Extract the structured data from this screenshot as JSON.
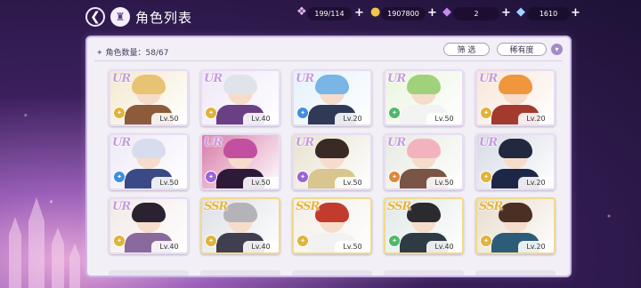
{
  "header": {
    "title": "角色列表"
  },
  "resources": [
    {
      "name": "candy",
      "icon": "candy-icon",
      "value": "199/114",
      "color": "#e7b6f0"
    },
    {
      "name": "coin",
      "icon": "coin-icon",
      "value": "1907800",
      "color": "#f3c54a"
    },
    {
      "name": "gem-purple",
      "icon": "gem-icon",
      "value": "2",
      "color": "#c48af0"
    },
    {
      "name": "gem-blue",
      "icon": "diamond-icon",
      "value": "1610",
      "color": "#9ed4ff"
    }
  ],
  "panel": {
    "count_label": "角色数量：58/67",
    "filter_label": "筛 选",
    "sort_label": "稀有度"
  },
  "cards": [
    {
      "rarity": "UR",
      "level": "Lv.50",
      "hair": "#e9c374",
      "outfit": "#8b5b3a",
      "bg": "#f3e9cf",
      "attr": "#e1b33a"
    },
    {
      "rarity": "UR",
      "level": "Lv.40",
      "hair": "#dfe3ea",
      "outfit": "#6b3f84",
      "bg": "#efe7f7",
      "attr": "#e1b33a"
    },
    {
      "rarity": "UR",
      "level": "Lv.20",
      "hair": "#79b6e6",
      "outfit": "#2f3a56",
      "bg": "#e4f1fa",
      "attr": "#3f8ee0"
    },
    {
      "rarity": "UR",
      "level": "Lv.50",
      "hair": "#9fd27a",
      "outfit": "#f3f3f3",
      "bg": "#eaf5e0",
      "attr": "#4fb86a"
    },
    {
      "rarity": "UR",
      "level": "Lv.20",
      "hair": "#f0963c",
      "outfit": "#a33a2e",
      "bg": "#f8e6d8",
      "attr": "#e1b33a"
    },
    {
      "rarity": "UR",
      "level": "Lv.50",
      "hair": "#d8dcef",
      "outfit": "#3a4a86",
      "bg": "#eeeaf7",
      "attr": "#3f8ee0"
    },
    {
      "rarity": "UR",
      "level": "Lv.50",
      "hair": "#c24fa0",
      "outfit": "#2c1a38",
      "bg": "#d97aa8",
      "attr": "#9a63d8"
    },
    {
      "rarity": "UR",
      "level": "Lv.50",
      "hair": "#3a2a26",
      "outfit": "#d8c58f",
      "bg": "#e7e2cf",
      "attr": "#9a63d8"
    },
    {
      "rarity": "UR",
      "level": "Lv.50",
      "hair": "#f2b3bf",
      "outfit": "#7a5444",
      "bg": "#e6ebe0",
      "attr": "#d98a3a"
    },
    {
      "rarity": "UR",
      "level": "Lv.20",
      "hair": "#22283f",
      "outfit": "#1e2648",
      "bg": "#d6dbe4",
      "attr": "#e1b33a"
    },
    {
      "rarity": "UR",
      "level": "Lv.40",
      "hair": "#2a2230",
      "outfit": "#8a6a9c",
      "bg": "#f1e9e6",
      "attr": "#e1b33a"
    },
    {
      "rarity": "SSR",
      "level": "Lv.40",
      "hair": "#b3b3b8",
      "outfit": "#3f3f4f",
      "bg": "#dddfe5",
      "attr": "#e1b33a"
    },
    {
      "rarity": "SSR",
      "level": "Lv.50",
      "hair": "#c23b2c",
      "outfit": "#f2f2f2",
      "bg": "#f3ede6",
      "attr": "#e1b33a"
    },
    {
      "rarity": "SSR",
      "level": "Lv.40",
      "hair": "#2b2a2e",
      "outfit": "#2f3b44",
      "bg": "#dfe8e6",
      "attr": "#4fb86a"
    },
    {
      "rarity": "SSR",
      "level": "Lv.20",
      "hair": "#4a2f22",
      "outfit": "#2c5c78",
      "bg": "#e6dccb",
      "attr": "#e1b33a"
    }
  ]
}
